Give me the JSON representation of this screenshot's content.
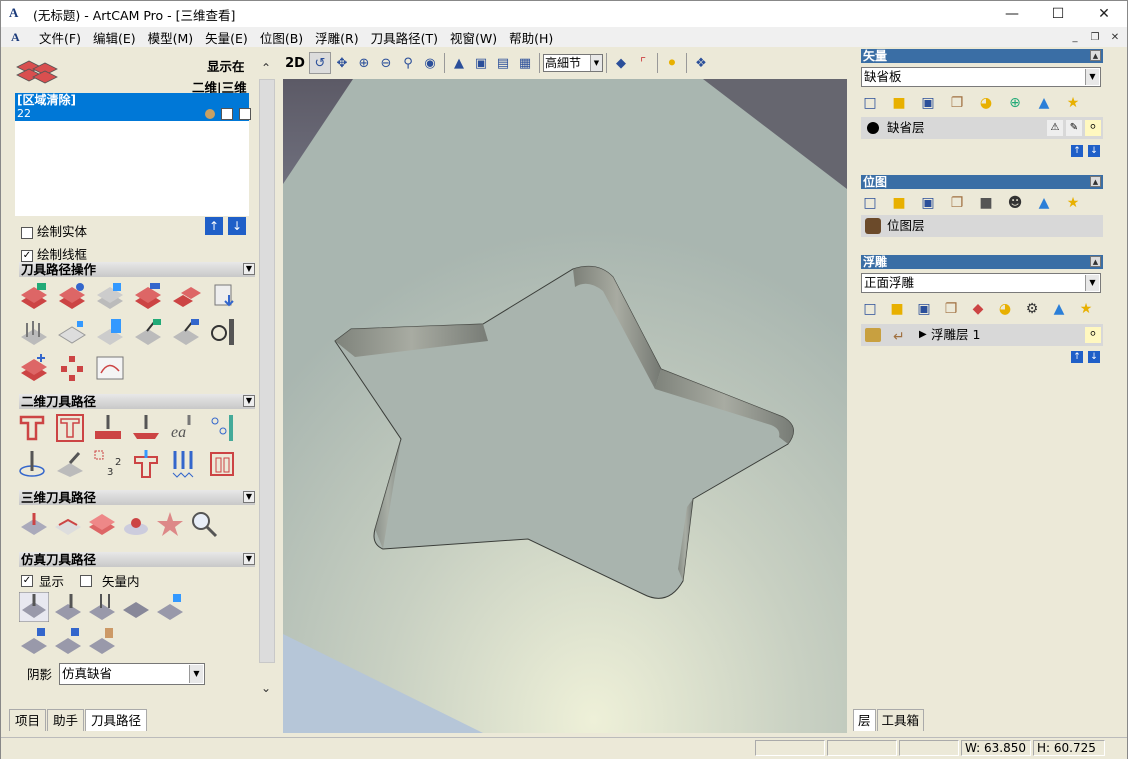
{
  "window": {
    "title": "(无标题) - ArtCAM Pro - [三维查看]",
    "logo": "A"
  },
  "menu": [
    "文件(F)",
    "编辑(E)",
    "模型(M)",
    "矢量(E)",
    "位图(B)",
    "浮雕(R)",
    "刀具路径(T)",
    "视窗(W)",
    "帮助(H)"
  ],
  "left": {
    "display_label": "显示在",
    "dim_label": "二维|三维",
    "toolpath_title": "[区域清除]",
    "toolpath_id": "22",
    "draw_solid": "绘制实体",
    "draw_wireframe": "绘制线框",
    "sections": {
      "ops": "刀具路径操作",
      "two_d": "二维刀具路径",
      "three_d": "三维刀具路径",
      "sim": "仿真刀具路径"
    },
    "sim_show": "显示",
    "sim_in_vector": "矢量内",
    "shade_label": "阴影",
    "shade_value": "仿真缺省"
  },
  "left_tabs": [
    "项目",
    "助手",
    "刀具路径"
  ],
  "view_toolbar": {
    "mode_2d": "2D",
    "quality": "高細节"
  },
  "right": {
    "vector_header": "矢量",
    "vector_select": "缺省板",
    "vector_layer": "缺省层",
    "bitmap_header": "位图",
    "bitmap_layer": "位图层",
    "relief_header": "浮雕",
    "relief_select": "正面浮雕",
    "relief_layer": "浮雕层 1"
  },
  "right_tabs": [
    "层",
    "工具箱"
  ],
  "status": {
    "width": "W: 63.850",
    "height": "H: 60.725"
  },
  "colors": {
    "accent": "#3a6ea5",
    "selection": "#0078d7"
  }
}
